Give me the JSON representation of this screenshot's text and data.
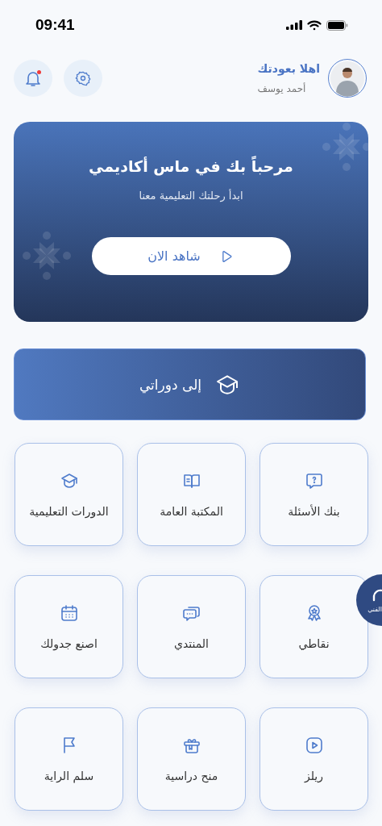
{
  "status_bar": {
    "time": "09:41"
  },
  "header": {
    "greeting": "اهلا بعودتك",
    "user_name": "أحمد يوسف",
    "notifications_unread": true
  },
  "banner": {
    "title": "مرحباً بك في ماس أكاديمي",
    "subtitle": "ابدأ رحلتك التعليمية معنا",
    "button": "شاهد الان"
  },
  "courses_button": {
    "label": "إلى دوراتي"
  },
  "tiles": [
    {
      "label": "بنك الأسئلة"
    },
    {
      "label": "المكتبة العامة"
    },
    {
      "label": "الدورات التعليمية"
    },
    {
      "label": "نقاطي"
    },
    {
      "label": "المنتدي"
    },
    {
      "label": "اصنع جدولك"
    },
    {
      "label": "ريلز"
    },
    {
      "label": "منح دراسية"
    },
    {
      "label": "سلم الراية"
    }
  ],
  "support_button": {
    "label": "الفني"
  }
}
